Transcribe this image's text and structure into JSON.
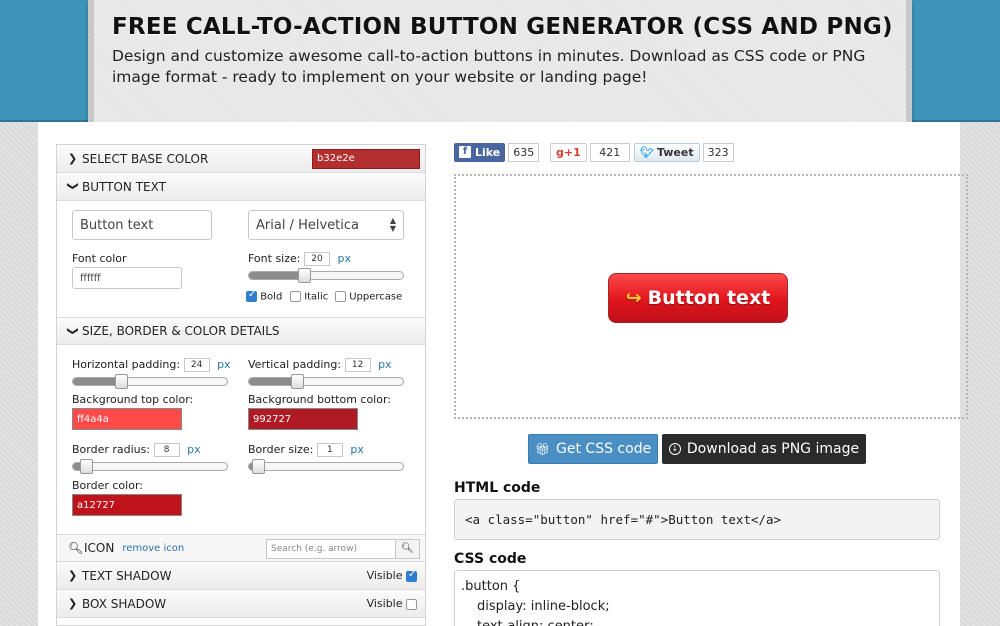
{
  "header": {
    "title": "FREE CALL-TO-ACTION BUTTON GENERATOR (CSS AND PNG)",
    "subtitle": "Design and customize awesome call-to-action buttons in minutes. Download as CSS code or PNG image format - ready to implement on your website or landing page!"
  },
  "sections": {
    "base_color": {
      "label": "SELECT BASE COLOR",
      "value": "b32e2e",
      "color": "#b32e2e"
    },
    "button_text": {
      "label": "BUTTON TEXT",
      "text_value": "Button text",
      "font_family": "Arial / Helvetica",
      "font_color_label": "Font color",
      "font_color_value": "ffffff",
      "font_size_label": "Font size:",
      "font_size_value": "20",
      "font_size_level": 0.35,
      "px": "px",
      "bold_label": "Bold",
      "italic_label": "Italic",
      "uppercase_label": "Uppercase"
    },
    "details": {
      "label": "SIZE, BORDER & COLOR DETAILS",
      "h_padding_label": "Horizontal padding:",
      "h_padding_value": "24",
      "h_padding_level": 0.3,
      "v_padding_label": "Vertical padding:",
      "v_padding_value": "12",
      "v_padding_level": 0.3,
      "bg_top_label": "Background top color:",
      "bg_top_value": "ff4a4a",
      "bg_top_color": "#ff4a4a",
      "bg_bottom_label": "Background bottom color:",
      "bg_bottom_value": "992727",
      "bg_bottom_color": "#b01a24",
      "radius_label": "Border radius:",
      "radius_value": "8",
      "radius_level": 0.05,
      "border_size_label": "Border size:",
      "border_size_value": "1",
      "border_size_level": 0.02,
      "border_color_label": "Border color:",
      "border_color_value": "a12727",
      "border_color": "#c0121a"
    },
    "icon": {
      "label": "ICON",
      "remove_label": "remove icon",
      "search_placeholder": "Search (e.g. arrow)"
    },
    "text_shadow": {
      "label": "TEXT SHADOW",
      "visible_label": "Visible"
    },
    "box_shadow": {
      "label": "BOX SHADOW",
      "visible_label": "Visible"
    }
  },
  "social": {
    "like_label": "Like",
    "like_count": "635",
    "gplus_label": "+1",
    "gplus_count": "421",
    "tweet_label": "Tweet",
    "tweet_count": "323"
  },
  "preview": {
    "button_label": "Button text"
  },
  "actions": {
    "css_label": "Get CSS code",
    "png_label": "Download as PNG image"
  },
  "code": {
    "html_heading": "HTML code",
    "html_snippet": "<a class=\"button\" href=\"#\">Button text</a>",
    "css_heading": "CSS code",
    "css_line1": ".button {",
    "css_line2": "display: inline-block;",
    "css_line3": "text-align: center;"
  }
}
